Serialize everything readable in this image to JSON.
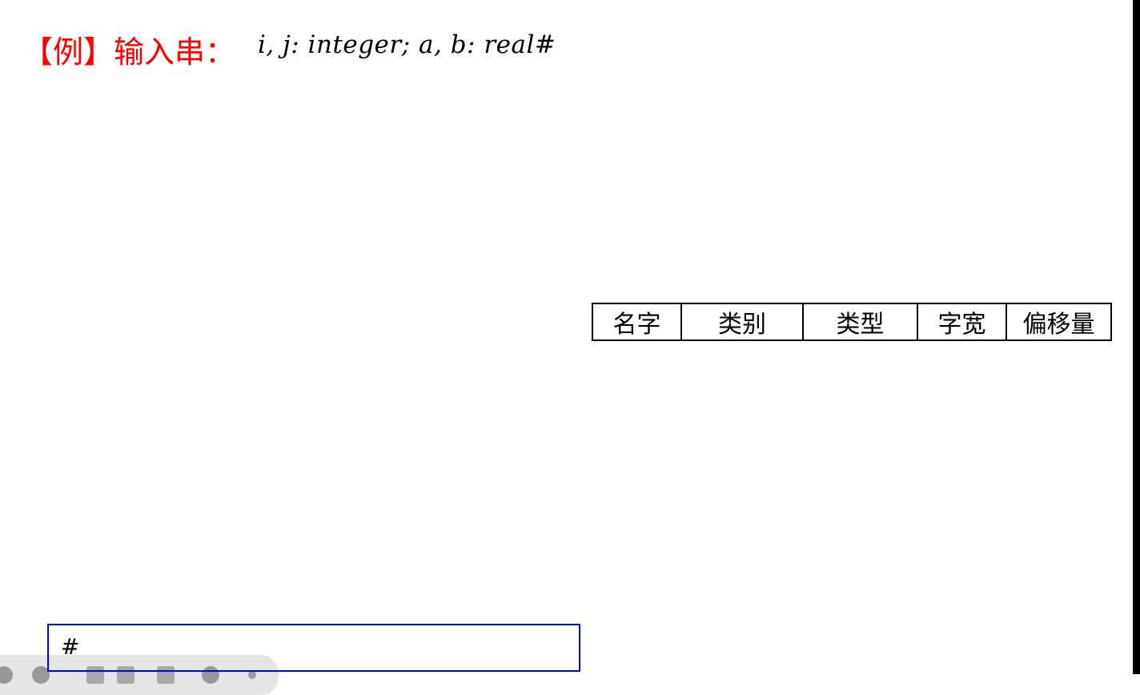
{
  "slide": {
    "title": "【例】输入串：",
    "input_string": "i, j: integer; a, b: real#"
  },
  "symbol_table": {
    "headers": [
      "名字",
      "类别",
      "类型",
      "字宽",
      "偏移量"
    ]
  },
  "input_box": {
    "value": "#"
  },
  "colors": {
    "title": "#ff0000",
    "input_border": "#0000ff"
  },
  "toolbar": {
    "icons": [
      "previous-icon",
      "next-icon",
      "pen-icon",
      "fullscreen-icon",
      "slides-icon",
      "zoom-icon",
      "more-icon"
    ]
  }
}
